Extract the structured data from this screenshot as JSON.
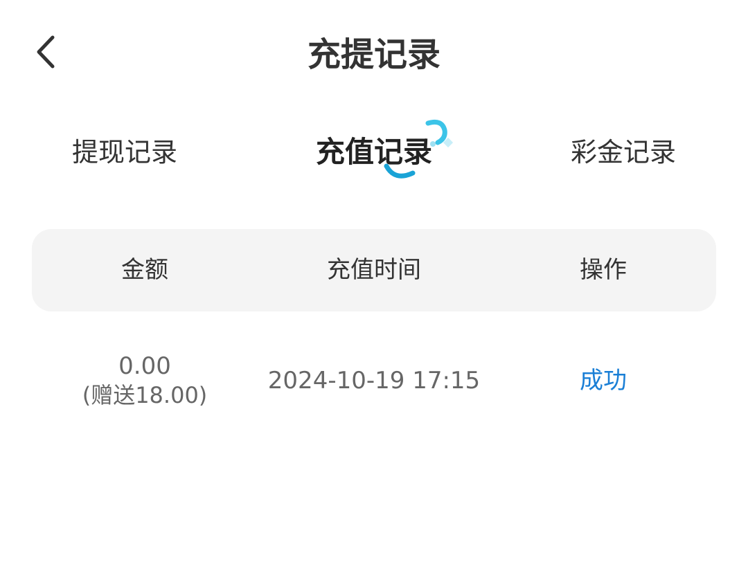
{
  "header": {
    "title": "充提记录",
    "back_icon": "chevron-left-icon"
  },
  "tabs": [
    {
      "label": "提现记录",
      "active": false
    },
    {
      "label": "充值记录",
      "active": true
    },
    {
      "label": "彩金记录",
      "active": false
    }
  ],
  "colors": {
    "accent": "#1aa3d6",
    "status_success": "#1a7fd6",
    "table_header_bg": "#f4f4f4"
  },
  "table": {
    "columns": [
      "金额",
      "充值时间",
      "操作"
    ],
    "rows": [
      {
        "amount": "0.00",
        "bonus": "(赠送18.00)",
        "time": "2024-10-19 17:15",
        "status": "成功"
      }
    ]
  }
}
